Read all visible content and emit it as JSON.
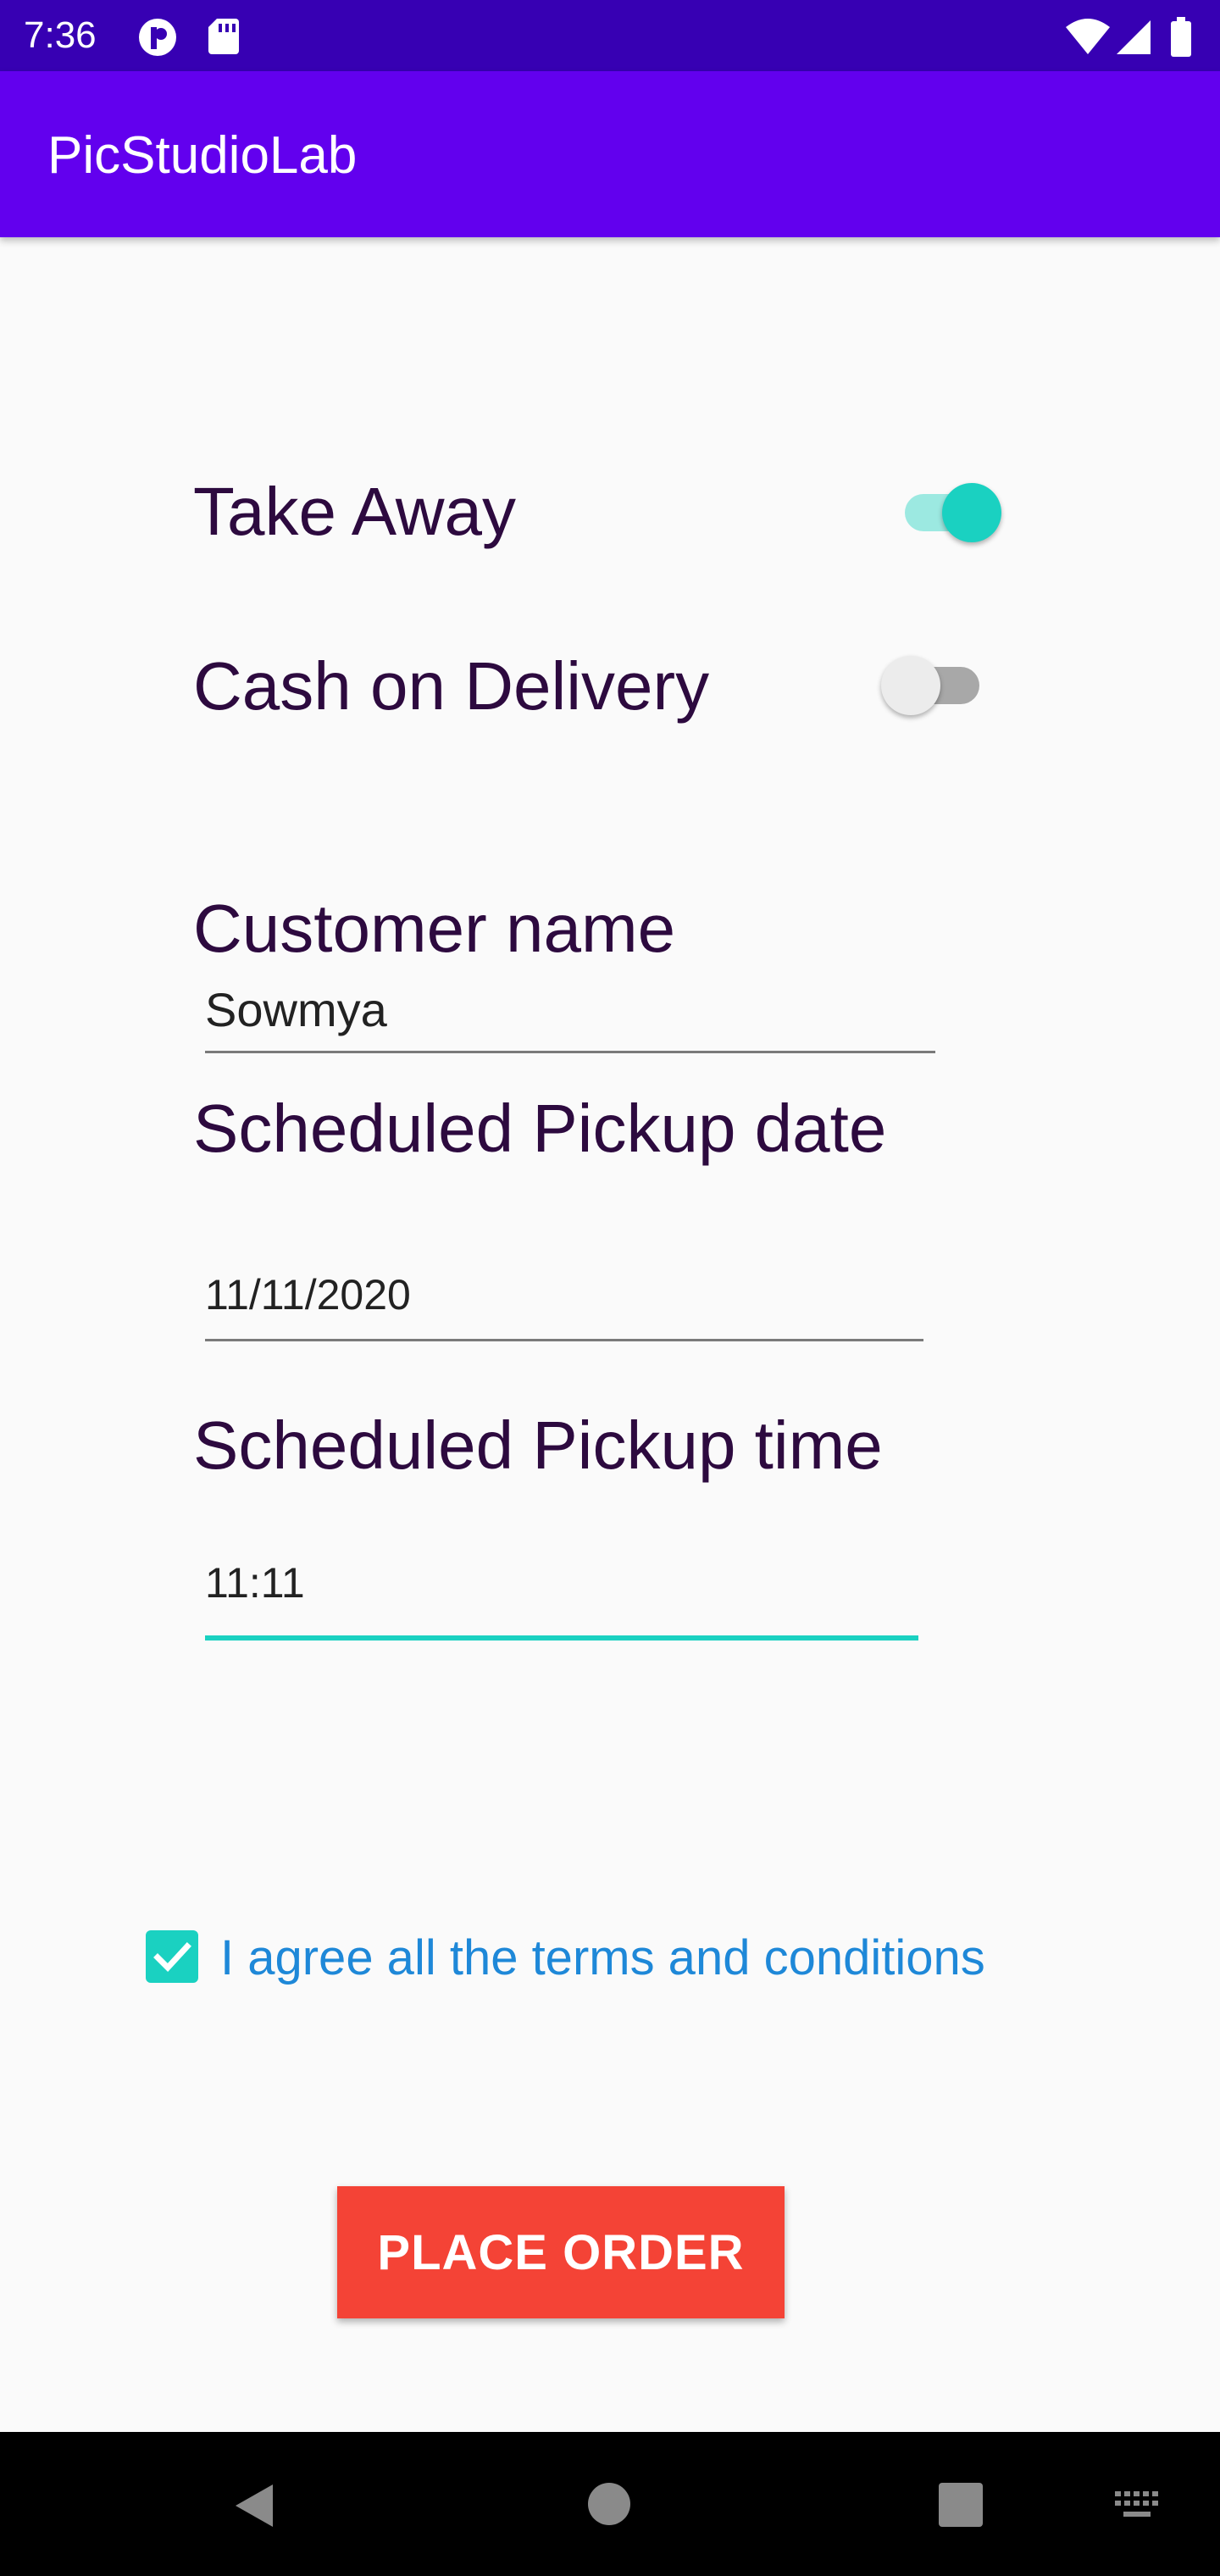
{
  "status_bar": {
    "time": "7:36",
    "icons": [
      "notification-icon",
      "sd-card-icon",
      "wifi-icon",
      "signal-icon",
      "battery-icon"
    ]
  },
  "app_bar": {
    "title": "PicStudioLab"
  },
  "form": {
    "take_away": {
      "label": "Take Away",
      "checked": true
    },
    "cash_on_delivery": {
      "label": "Cash on Delivery",
      "checked": false
    },
    "customer_name": {
      "label": "Customer name",
      "value": "Sowmya"
    },
    "pickup_date": {
      "label": "Scheduled Pickup date",
      "value": "11/11/2020"
    },
    "pickup_time": {
      "label": "Scheduled Pickup time",
      "value": "11:11"
    },
    "terms": {
      "label": "I agree all the terms and conditions",
      "checked": true
    },
    "submit_label": "PLACE ORDER"
  },
  "colors": {
    "status_bar": "#3700b3",
    "app_bar": "#6200ee",
    "accent": "#1ad1c1",
    "button": "#f44336",
    "label_text": "#2d0a3f",
    "link_text": "#1e88d8"
  },
  "nav_bar": {
    "icons": [
      "back-icon",
      "home-icon",
      "recents-icon",
      "keyboard-icon"
    ]
  }
}
